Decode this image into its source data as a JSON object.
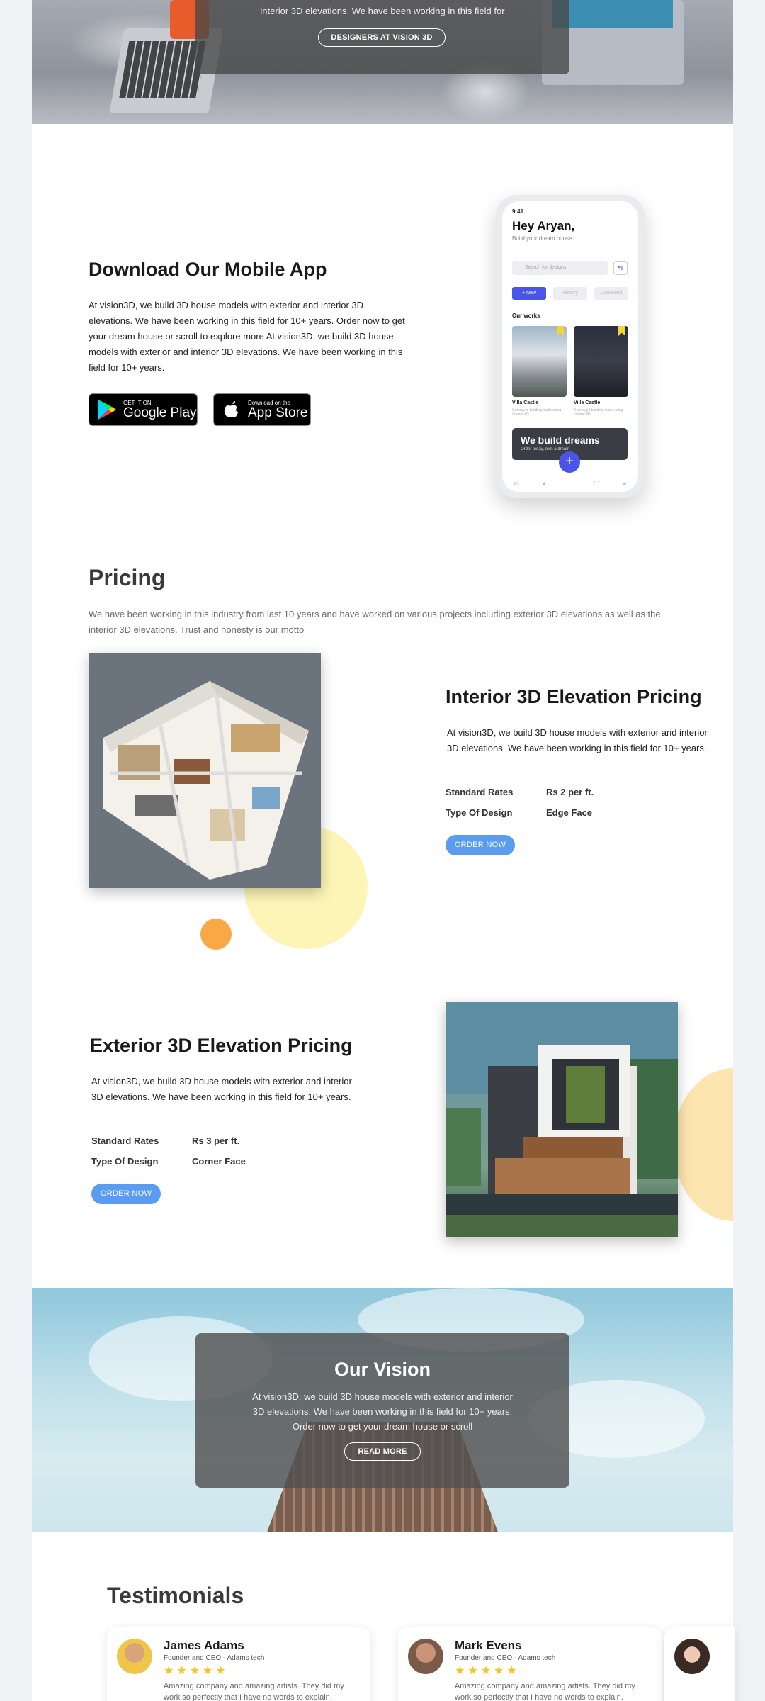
{
  "hero": {
    "text": "interior 3D elevations. We have been working in this field for",
    "button": "DESIGNERS AT VISION 3D"
  },
  "app": {
    "title": "Download Our Mobile App",
    "text": "At vision3D, we build 3D house models with exterior and  interior 3D elevations. We have been working in this field for 10+ years. Order now to get your dream house or scroll to explore more At vision3D, we build 3D house models with exterior and interior 3D elevations. We have been working in this field for 10+ years.",
    "google_play": {
      "small": "GET IT ON",
      "big": "Google Play"
    },
    "app_store": {
      "small": "Download on the",
      "big": "App Store"
    }
  },
  "phone": {
    "time": "9:41",
    "greeting": "Hey Aryan,",
    "subtitle": "Build your dream house",
    "search_placeholder": "Search for designs",
    "pills": [
      "+ New",
      "History",
      "Cancelled"
    ],
    "our_works": "Our works",
    "cards": [
      {
        "title": "Villa Castle",
        "desc": "3 storeyed building made using civame 4D"
      },
      {
        "title": "Villa Castle",
        "desc": "3 storeyed building made using civame 4D"
      }
    ],
    "banner_title": "We build dreams",
    "banner_sub": "Order today, own a dream"
  },
  "pricing": {
    "title": "Pricing",
    "text": "We have been working in this industry from last 10 years and have worked on various projects including exterior 3D elevations as well as the interior 3D elevations. Trust and honesty is our motto"
  },
  "interior": {
    "title": "Interior 3D Elevation Pricing",
    "text": "At vision3D, we build 3D house models with exterior and interior 3D elevations. We have been working in this field for 10+ years.",
    "rate_label": "Standard Rates",
    "rate_value": "Rs 2 per ft.",
    "design_label": "Type Of Design",
    "design_value": "Edge Face",
    "order": "ORDER NOW"
  },
  "exterior": {
    "title": "Exterior 3D Elevation Pricing",
    "text": "At vision3D, we build 3D house models with exterior and interior 3D elevations. We have been working in this field for 10+ years.",
    "rate_label": "Standard Rates",
    "rate_value": "Rs 3 per ft.",
    "design_label": "Type Of Design",
    "design_value": "Corner Face",
    "order": "ORDER NOW"
  },
  "vision": {
    "title": "Our Vision",
    "text": "At vision3D, we build 3D house models with exterior and interior 3D elevations. We have been working in this field for 10+ years. Order now to get your dream house or scroll",
    "button": "READ MORE"
  },
  "testimonials": {
    "title": "Testimonials",
    "items": [
      {
        "name": "James Adams",
        "role": "Founder and CEO - Adams tech",
        "stars": 5,
        "stars_text": "★★★★★",
        "quote": "Amazing company and amazing artists. They did my work so perfectly that I have no words to explain."
      },
      {
        "name": "Mark Evens",
        "role": "Founder and CEO - Adams tech",
        "stars": 5,
        "stars_text": "★★★★★",
        "quote": "Amazing company and amazing artists. They did my work so perfectly that I have no words to explain."
      }
    ]
  },
  "colors": {
    "accent_blue": "#5b9bf0",
    "phone_accent": "#4a54e8",
    "star": "#f7c51c",
    "circle_yellow": "#fdf5b5",
    "circle_orange": "#f9a846"
  }
}
